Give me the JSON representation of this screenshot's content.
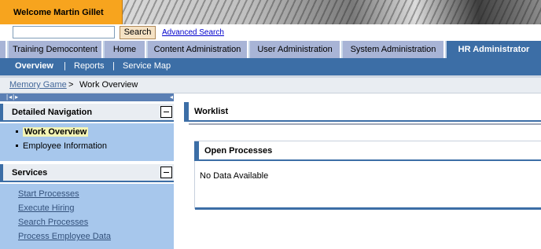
{
  "header": {
    "welcome_text": "Welcome Martin Gillet",
    "search_button": "Search",
    "search_value": "",
    "advanced_search": "Advanced Search"
  },
  "tabs": [
    {
      "label": "Training Democontent"
    },
    {
      "label": "Home"
    },
    {
      "label": "Content Administration"
    },
    {
      "label": "User Administration"
    },
    {
      "label": "System Administration"
    },
    {
      "label": "HR Administrator",
      "active": true
    }
  ],
  "subnav": [
    {
      "label": "Overview",
      "active": true
    },
    {
      "label": "Reports"
    },
    {
      "label": "Service Map"
    }
  ],
  "subnav_separator": "|",
  "breadcrumb": {
    "link": "Memory Game",
    "separator": ">",
    "current": "Work Overview"
  },
  "detailed_navigation": {
    "title": "Detailed Navigation",
    "items": [
      {
        "label": "Work Overview",
        "active": true
      },
      {
        "label": "Employee Information"
      }
    ]
  },
  "services": {
    "title": "Services",
    "links": [
      "Start Processes",
      "Execute Hiring",
      "Search Processes",
      "Process Employee Data"
    ]
  },
  "content": {
    "worklist_title": "Worklist",
    "open_processes_title": "Open Processes",
    "open_processes_empty": "No Data Available"
  },
  "colors": {
    "welcome_bg": "#f7a41e",
    "nav_blue": "#3c6ea6",
    "tab_bg": "#a8b4d6",
    "leftnav_bg": "#a7c7ec",
    "link": "#34527c"
  },
  "icons": [
    "collapse-left-icon",
    "expand-right-icon",
    "panel-collapse-icon"
  ]
}
